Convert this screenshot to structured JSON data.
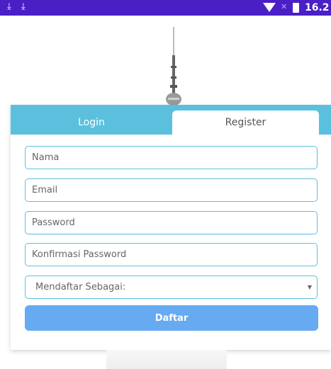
{
  "status_bar": {
    "time": "16.2",
    "icons": [
      "download-icon",
      "download-icon",
      "wifi-icon",
      "no-signal-icon",
      "battery-icon"
    ]
  },
  "tabs": {
    "login_label": "Login",
    "register_label": "Register",
    "active": "Register"
  },
  "form": {
    "name_placeholder": "Nama",
    "email_placeholder": "Email",
    "password_placeholder": "Password",
    "confirm_password_placeholder": "Konfirmasi Password",
    "role_select_value": "Mendaftar Sebagai:",
    "submit_label": "Daftar"
  },
  "colors": {
    "status_bar": "#4a1fc6",
    "tab_bar": "#5bc0de",
    "input_border": "#5bc0de",
    "button": "#66aaf2"
  }
}
